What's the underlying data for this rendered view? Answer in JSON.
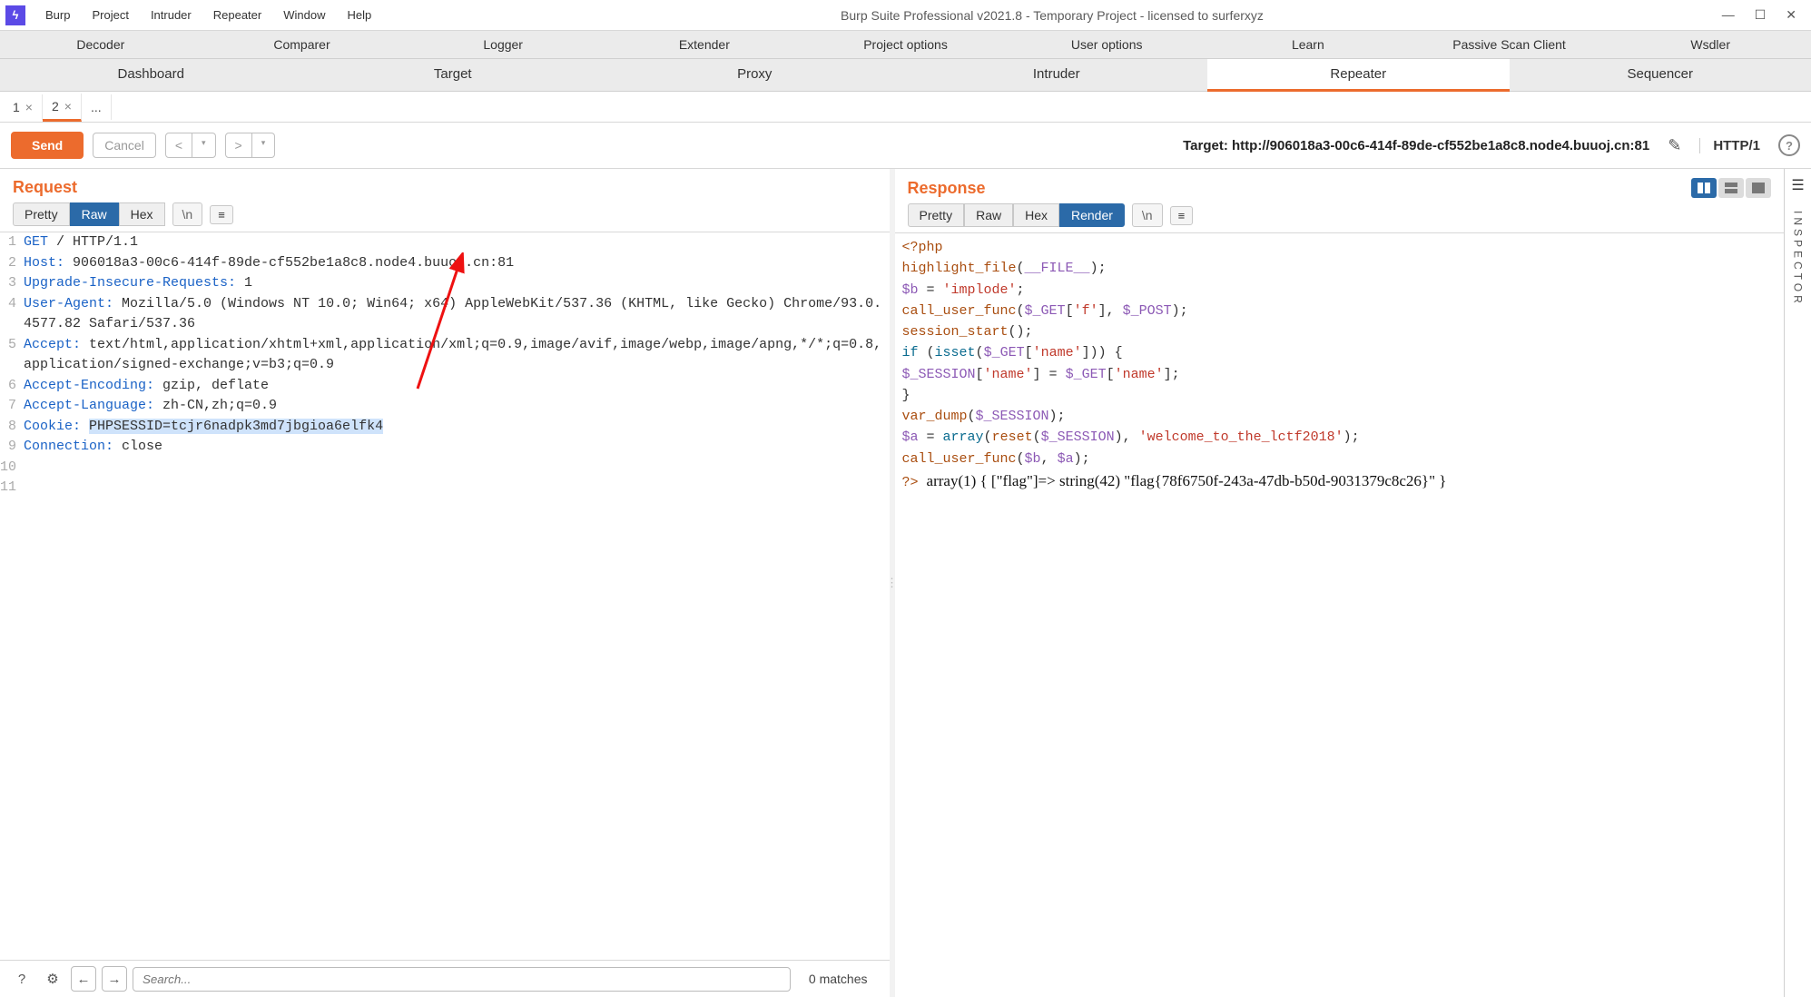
{
  "title": "Burp Suite Professional v2021.8 - Temporary Project - licensed to surferxyz",
  "menu": [
    "Burp",
    "Project",
    "Intruder",
    "Repeater",
    "Window",
    "Help"
  ],
  "tabs_row1": [
    "Decoder",
    "Comparer",
    "Logger",
    "Extender",
    "Project options",
    "User options",
    "Learn",
    "Passive Scan Client",
    "Wsdler"
  ],
  "tabs_row2": [
    "Dashboard",
    "Target",
    "Proxy",
    "Intruder",
    "Repeater",
    "Sequencer"
  ],
  "active_main_tab": "Repeater",
  "sub_tabs": [
    {
      "label": "1",
      "closable": true,
      "active": false
    },
    {
      "label": "2",
      "closable": true,
      "active": true
    },
    {
      "label": "...",
      "closable": false,
      "active": false
    }
  ],
  "action_bar": {
    "send": "Send",
    "cancel": "Cancel",
    "target_label": "Target: ",
    "target_value": "http://906018a3-00c6-414f-89de-cf552be1a8c8.node4.buuoj.cn:81",
    "http_ver": "HTTP/1"
  },
  "request": {
    "title": "Request",
    "view_tabs": [
      "Pretty",
      "Raw",
      "Hex"
    ],
    "escaped": "\\n",
    "active_view": "Raw",
    "lines": [
      {
        "n": 1,
        "t": "GET / HTTP/1.1"
      },
      {
        "n": 2,
        "t": "Host: 906018a3-00c6-414f-89de-cf552be1a8c8.node4.buuoj.cn:81"
      },
      {
        "n": 3,
        "t": "Upgrade-Insecure-Requests: 1"
      },
      {
        "n": 4,
        "t": "User-Agent: Mozilla/5.0 (Windows NT 10.0; Win64; x64) AppleWebKit/537.36 (KHTML, like Gecko) Chrome/93.0.4577.82 Safari/537.36"
      },
      {
        "n": 5,
        "t": "Accept: text/html,application/xhtml+xml,application/xml;q=0.9,image/avif,image/webp,image/apng,*/*;q=0.8,application/signed-exchange;v=b3;q=0.9"
      },
      {
        "n": 6,
        "t": "Accept-Encoding: gzip, deflate"
      },
      {
        "n": 7,
        "t": "Accept-Language: zh-CN,zh;q=0.9"
      },
      {
        "n": 8,
        "header": "Cookie: ",
        "cookie_name": "PHPSESSID=",
        "cookie_val": "tcjr6nadpk3md7jbgioa6elfk4"
      },
      {
        "n": 9,
        "t": "Connection: close"
      },
      {
        "n": 10,
        "t": ""
      },
      {
        "n": 11,
        "t": ""
      }
    ]
  },
  "response": {
    "title": "Response",
    "view_tabs": [
      "Pretty",
      "Raw",
      "Hex",
      "Render"
    ],
    "escaped": "\\n",
    "active_view": "Render",
    "php_lines": [
      "<?php",
      "highlight_file(__FILE__);",
      "$b = 'implode';",
      "call_user_func($_GET['f'], $_POST);",
      "session_start();",
      "if (isset($_GET['name'])) {",
      "    $_SESSION['name'] = $_GET['name'];",
      "}",
      "var_dump($_SESSION);",
      "$a = array(reset($_SESSION), 'welcome_to_the_lctf2018');",
      "call_user_func($b, $a);"
    ],
    "output": "?> array(1) { [\"flag\"]=> string(42) \"flag{78f6750f-243a-47db-b50d-9031379c8c26}\" }"
  },
  "statusbar": {
    "placeholder": "Search...",
    "matches": "0 matches"
  },
  "inspector": "INSPECTOR"
}
